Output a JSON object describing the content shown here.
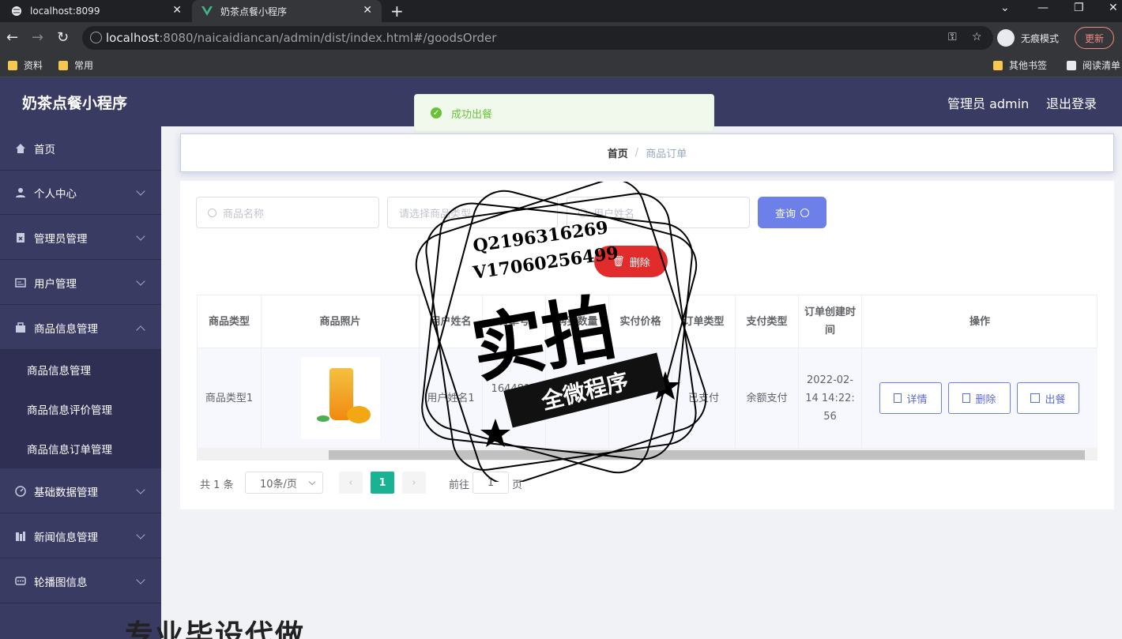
{
  "browser": {
    "tabs": [
      {
        "title": "localhost:8099",
        "active": false
      },
      {
        "title": "奶茶点餐小程序",
        "active": true
      }
    ],
    "url_host": "localhost",
    "url_rest": ":8080/naicaidiancan/admin/dist/index.html#/goodsOrder",
    "incognito_label": "无痕模式",
    "update_label": "更新",
    "bookmarks": [
      "资料",
      "常用"
    ],
    "bookmarks_right": [
      "其他书签",
      "阅读清单"
    ]
  },
  "app": {
    "title": "奶茶点餐小程序",
    "user_label": "管理员 admin",
    "logout_label": "退出登录"
  },
  "sidebar": {
    "items": [
      {
        "label": "首页",
        "icon": "home-icon"
      },
      {
        "label": "个人中心",
        "icon": "user-icon"
      },
      {
        "label": "管理员管理",
        "icon": "admin-icon"
      },
      {
        "label": "用户管理",
        "icon": "users-icon"
      },
      {
        "label": "商品信息管理",
        "icon": "goods-icon"
      },
      {
        "label": "基础数据管理",
        "icon": "data-icon"
      },
      {
        "label": "新闻信息管理",
        "icon": "news-icon"
      },
      {
        "label": "轮播图信息",
        "icon": "carousel-icon"
      }
    ],
    "subitems": [
      "商品信息管理",
      "商品信息评价管理",
      "商品信息订单管理"
    ]
  },
  "toast": {
    "message": "成功出餐"
  },
  "breadcrumb": {
    "home": "首页",
    "separator": "/",
    "current": "商品订单"
  },
  "search": {
    "name_placeholder": "商品名称",
    "type_placeholder": "请选择商品类型",
    "user_placeholder": "用户姓名",
    "query_label": "查询",
    "delete_label": "删除"
  },
  "table": {
    "headers": [
      "商品类型",
      "商品照片",
      "用户姓名",
      "订单号",
      "购买数量",
      "实付价格",
      "订单类型",
      "支付类型",
      "订单创建时间",
      "操作"
    ],
    "row": {
      "type": "商品类型1",
      "user": "用户姓名1",
      "order_no": "164481977",
      "order_type": "已支付",
      "pay_type": "余额支付",
      "created": "2022-02-14 14:22:56"
    },
    "actions": {
      "detail": "详情",
      "delete": "删除",
      "serve": "出餐"
    }
  },
  "pagination": {
    "total": "共 1 条",
    "page_size": "10条/页",
    "current": "1",
    "goto_label": "前往",
    "goto_value": "1",
    "goto_unit": "页"
  },
  "overlay": {
    "contact_q": "Q2196316269",
    "contact_v": "V17060256499",
    "stamp_main": "实拍",
    "stamp_band": "全微程序",
    "bottom_text": "专业毕设代做"
  },
  "colors": {
    "sidebar_bg": "#3a3b63",
    "primary": "#6d7fe8",
    "danger": "#e22c2c",
    "page_active": "#19b393",
    "success": "#67c23a"
  }
}
